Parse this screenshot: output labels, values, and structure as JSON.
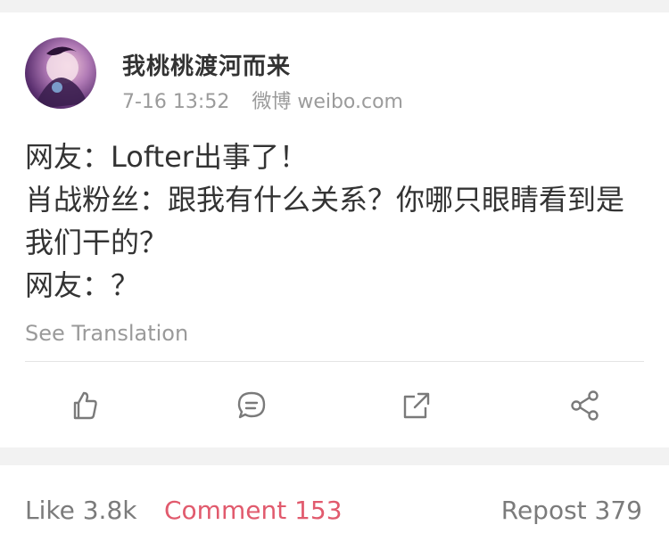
{
  "post": {
    "username": "我桃桃渡河而来",
    "timestamp": "7-16 13:52",
    "source": "微博 weibo.com",
    "lines": [
      "网友：Lofter出事了！",
      "肖战粉丝：跟我有什么关系？你哪只眼睛看到是我们干的？",
      "网友：？"
    ],
    "see_translation": "See Translation"
  },
  "actions": {
    "icons": [
      "thumbs-up-icon",
      "comment-icon",
      "share-arrow-icon",
      "share-nodes-icon"
    ]
  },
  "stats": {
    "like_label": "Like 3.8k",
    "comment_label": "Comment 153",
    "repost_label": "Repost 379"
  },
  "colors": {
    "accent": "#e15a6d",
    "muted": "#9b9b9b",
    "text": "#333333",
    "background": "#f2f2f2"
  }
}
